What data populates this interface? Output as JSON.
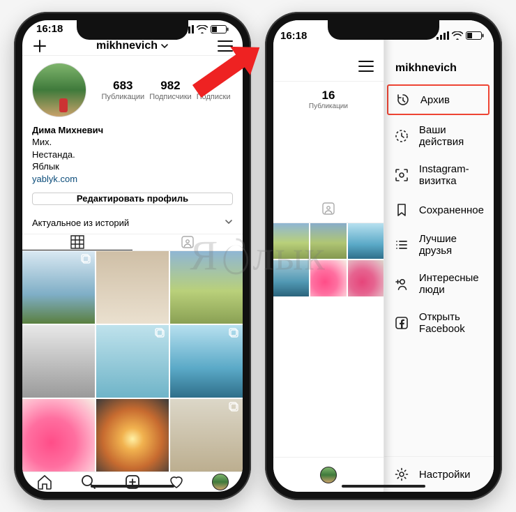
{
  "status": {
    "time": "16:18"
  },
  "profile": {
    "username": "mikhnevich",
    "posts_count": "683",
    "posts_label": "Публикации",
    "followers_count": "982",
    "followers_label": "Подписчики",
    "following_label": "Подписки",
    "bio_name": "Дима Михневич",
    "bio_line1": "Мих.",
    "bio_line2": "Нестанда.",
    "bio_line3": "Яблык",
    "bio_link": "yablyk.com",
    "edit_label": "Редактировать профиль",
    "highlights_label": "Актуальное из историй"
  },
  "right_profile": {
    "posts_count": "16",
    "posts_label": "Публикации"
  },
  "menu": {
    "title": "mikhnevich",
    "items": [
      {
        "label": "Архив",
        "icon": "history"
      },
      {
        "label": "Ваши действия",
        "icon": "clock"
      },
      {
        "label": "Instagram-визитка",
        "icon": "scan"
      },
      {
        "label": "Сохраненное",
        "icon": "bookmark"
      },
      {
        "label": "Лучшие друзья",
        "icon": "list"
      },
      {
        "label": "Интересные люди",
        "icon": "addperson"
      },
      {
        "label": "Открыть Facebook",
        "icon": "facebook"
      }
    ],
    "settings_label": "Настройки"
  },
  "watermark": {
    "left": "Я",
    "right": "лык"
  }
}
